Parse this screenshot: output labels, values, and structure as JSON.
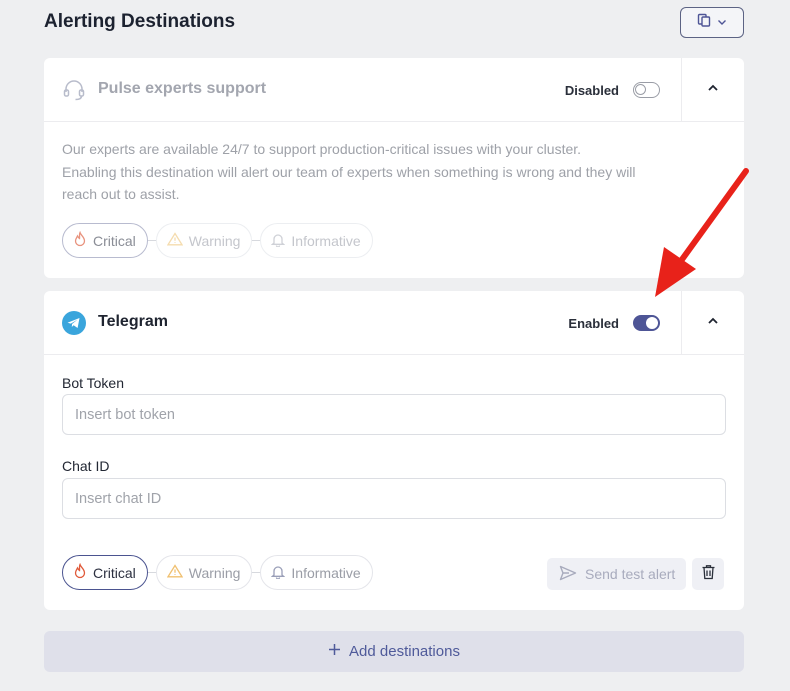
{
  "page": {
    "title": "Alerting Destinations"
  },
  "destinations": [
    {
      "name": "Pulse experts support",
      "icon": "headset-icon",
      "status": "Disabled",
      "enabled": false,
      "description_lines": [
        "Our experts are available 24/7 to support production-critical issues with your cluster.",
        "Enabling this destination will alert our team of experts when something is wrong and they will",
        "reach out to assist."
      ],
      "severities": [
        "Critical",
        "Warning",
        "Informative"
      ]
    },
    {
      "name": "Telegram",
      "icon": "telegram-icon",
      "status": "Enabled",
      "enabled": true,
      "fields": {
        "bot_token": {
          "label": "Bot Token",
          "placeholder": "Insert bot token",
          "value": ""
        },
        "chat_id": {
          "label": "Chat ID",
          "placeholder": "Insert chat ID",
          "value": ""
        }
      },
      "severities": [
        "Critical",
        "Warning",
        "Informative"
      ],
      "test_button": "Send test alert"
    }
  ],
  "add_button": "Add destinations",
  "colors": {
    "accent": "#4e5596",
    "critical": "#e05a3a",
    "warning": "#f0c070",
    "annotation_arrow": "#e8221a"
  }
}
